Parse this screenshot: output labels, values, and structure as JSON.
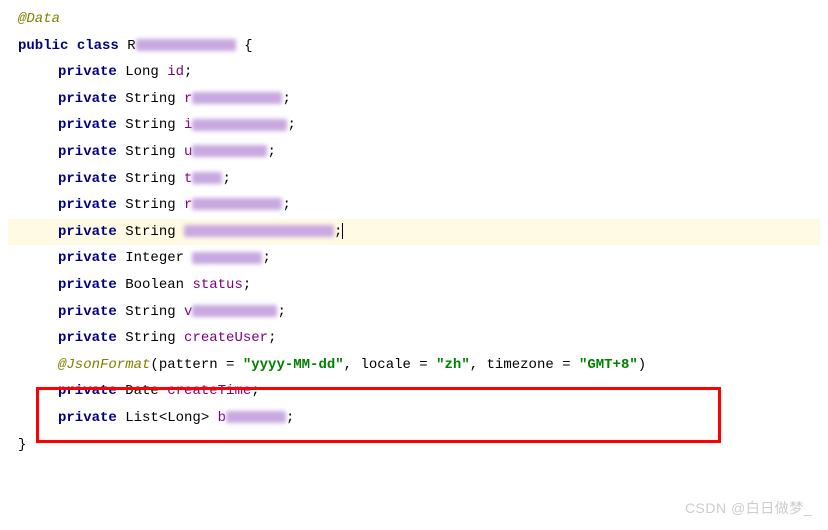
{
  "code": {
    "annotation_data": "@Data",
    "kw_public": "public",
    "kw_class": "class",
    "class_prefix": "R",
    "brace_open": "{",
    "brace_close": "}",
    "kw_private": "private",
    "types": {
      "Long": "Long",
      "String": "String",
      "Integer": "Integer",
      "Boolean": "Boolean",
      "Date": "Date",
      "List": "List<Long>"
    },
    "fields": {
      "id": "id",
      "status": "status",
      "createUser": "createUser",
      "createTime": "createTime",
      "f2_prefix": "r",
      "f3_prefix": "i",
      "f4_prefix": "u",
      "f5_prefix": "t",
      "f6_prefix": "r",
      "f10_prefix": "v",
      "f12_prefix": "b"
    },
    "semicolon": ";",
    "jsonformat": {
      "annotation": "@JsonFormat",
      "open": "(",
      "p_pattern": "pattern = ",
      "v_pattern": "\"yyyy-MM-dd\"",
      "comma": ", ",
      "p_locale": "locale = ",
      "v_locale": "\"zh\"",
      "p_timezone": "timezone = ",
      "v_timezone": "\"GMT+8\"",
      "close": ")"
    }
  },
  "watermark": "CSDN @白日做梦_"
}
